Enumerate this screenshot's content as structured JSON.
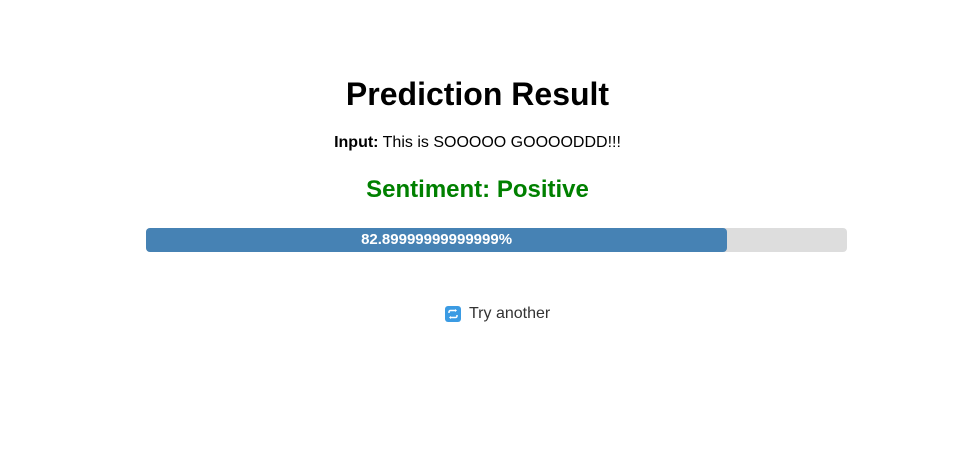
{
  "result": {
    "title": "Prediction Result",
    "input_label": "Input:",
    "input_text": "This is SOOOOO GOOOODDD!!!",
    "sentiment_text": "Sentiment: Positive",
    "confidence_label": "82.89999999999999%",
    "confidence_fraction": 0.829,
    "sentiment_color": "#008000",
    "bar_color": "#4682b4",
    "track_color": "#dddddd"
  },
  "actions": {
    "try_another_label": "Try another",
    "try_another_icon": "repeat-icon"
  }
}
